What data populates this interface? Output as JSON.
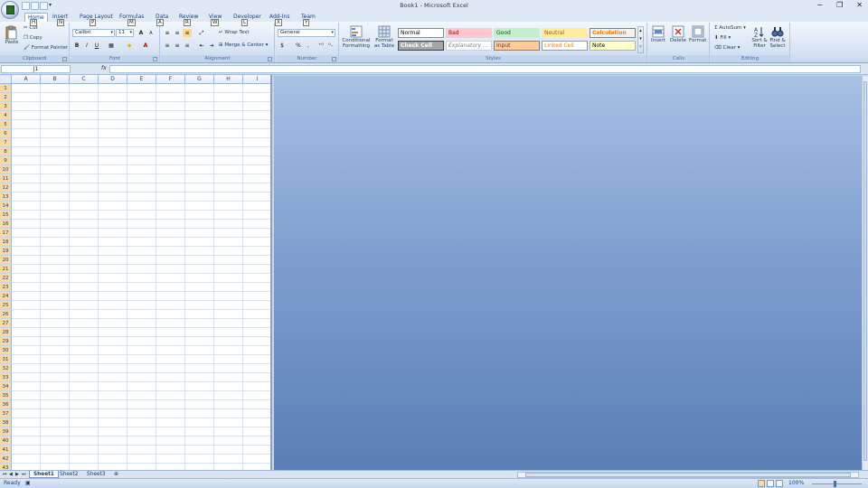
{
  "window": {
    "title": "Book1 - Microsoft Excel",
    "controls": [
      "−",
      "❐",
      "✕"
    ]
  },
  "tabs": [
    {
      "label": "Home",
      "key": "H",
      "active": true
    },
    {
      "label": "Insert",
      "key": "N"
    },
    {
      "label": "Page Layout",
      "key": "P"
    },
    {
      "label": "Formulas",
      "key": "M"
    },
    {
      "label": "Data",
      "key": "A"
    },
    {
      "label": "Review",
      "key": "R"
    },
    {
      "label": "View",
      "key": "W"
    },
    {
      "label": "Developer",
      "key": "L"
    },
    {
      "label": "Add-Ins",
      "key": "X"
    },
    {
      "label": "Team",
      "key": "Y"
    }
  ],
  "ribbon": {
    "clipboard": {
      "label": "Clipboard",
      "paste": "Paste",
      "cut": "Cut",
      "copy": "Copy",
      "format_painter": "Format Painter"
    },
    "font": {
      "label": "Font",
      "name": "Calibri",
      "size": "11",
      "bold": "B",
      "italic": "I",
      "underline": "U",
      "grow": "A",
      "shrink": "A"
    },
    "alignment": {
      "label": "Alignment",
      "wrap": "Wrap Text",
      "merge": "Merge & Center"
    },
    "number": {
      "label": "Number",
      "format": "General",
      "currency": "$",
      "percent": "%",
      "comma": ","
    },
    "styles": {
      "label": "Styles",
      "conditional": "Conditional Formatting",
      "format_table": "Format as Table",
      "cells": [
        {
          "text": "Normal",
          "bg": "#ffffff",
          "fg": "#000000",
          "border": "#8a8a8a"
        },
        {
          "text": "Bad",
          "bg": "#ffc7ce",
          "fg": "#9c0006",
          "border": "#ffc7ce"
        },
        {
          "text": "Good",
          "bg": "#c6efce",
          "fg": "#006100",
          "border": "#c6efce"
        },
        {
          "text": "Neutral",
          "bg": "#ffeb9c",
          "fg": "#9c6500",
          "border": "#ffeb9c"
        },
        {
          "text": "Calculation",
          "bg": "#f2f2f2",
          "fg": "#fa7d00",
          "border": "#7f7f7f"
        },
        {
          "text": "Check Cell",
          "bg": "#a5a5a5",
          "fg": "#ffffff",
          "border": "#3f3f3f"
        },
        {
          "text": "Explanatory ...",
          "bg": "#ffffff",
          "fg": "#7f7f7f",
          "border": "#d0d0d0"
        },
        {
          "text": "Input",
          "bg": "#ffcc99",
          "fg": "#3f3f76",
          "border": "#7f7f7f"
        },
        {
          "text": "Linked Cell",
          "bg": "#ffffff",
          "fg": "#fa7d00",
          "border": "#ff8001"
        },
        {
          "text": "Note",
          "bg": "#ffffcc",
          "fg": "#000000",
          "border": "#b2b2b2"
        }
      ]
    },
    "cells": {
      "label": "Cells",
      "insert": "Insert",
      "delete": "Delete",
      "format": "Format"
    },
    "editing": {
      "label": "Editing",
      "autosum": "AutoSum",
      "fill": "Fill",
      "clear": "Clear",
      "sort": "Sort & Filter",
      "find": "Find & Select"
    }
  },
  "formula_bar": {
    "name_box": "J1",
    "fx": "fx",
    "value": ""
  },
  "sheet": {
    "columns": [
      "A",
      "B",
      "C",
      "D",
      "E",
      "F",
      "G",
      "H",
      "I"
    ],
    "rows": [
      "1",
      "2",
      "3",
      "4",
      "5",
      "6",
      "7",
      "8",
      "9",
      "10",
      "11",
      "12",
      "13",
      "14",
      "15",
      "16",
      "17",
      "18",
      "19",
      "20",
      "21",
      "22",
      "23",
      "24",
      "25",
      "26",
      "27",
      "28",
      "29",
      "30",
      "31",
      "32",
      "33",
      "34",
      "35",
      "36",
      "37",
      "38",
      "39",
      "40",
      "41",
      "42",
      "43"
    ]
  },
  "sheet_tabs": [
    {
      "label": "Sheet1",
      "active": true
    },
    {
      "label": "Sheet2"
    },
    {
      "label": "Sheet3"
    }
  ],
  "status": {
    "text": "Ready",
    "zoom": "100%"
  }
}
